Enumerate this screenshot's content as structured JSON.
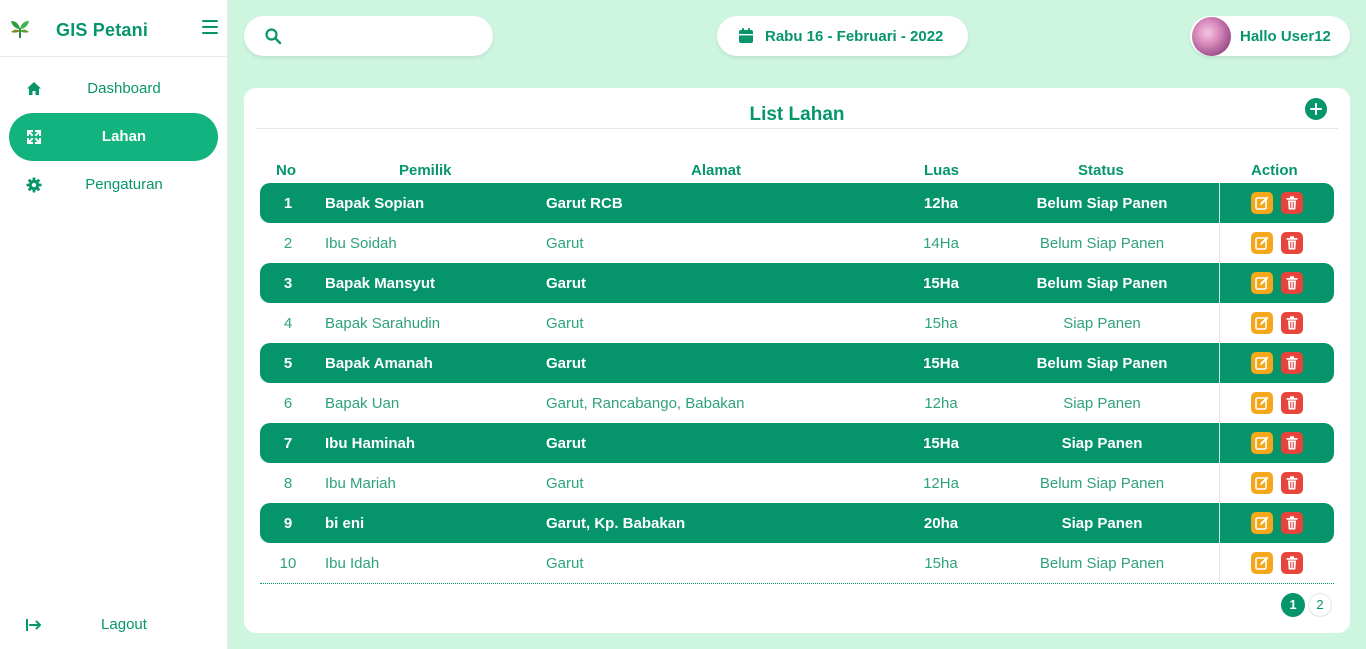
{
  "sidebar": {
    "brand": "GIS Petani",
    "items": [
      {
        "label": "Dashboard",
        "icon": "home-icon"
      },
      {
        "label": "Lahan",
        "icon": "expand-icon"
      },
      {
        "label": "Pengaturan",
        "icon": "gear-icon"
      }
    ],
    "logout": "Lagout"
  },
  "topbar": {
    "search": {
      "value": "",
      "placeholder": ""
    },
    "date": "Rabu 16 - Februari - 2022",
    "user": "Hallo User12"
  },
  "card": {
    "title": "List Lahan",
    "columns": [
      "No",
      "Pemilik",
      "Alamat",
      "Luas",
      "Status",
      "Action"
    ],
    "rows": [
      {
        "no": "1",
        "pemilik": "Bapak Sopian",
        "alamat": "Garut RCB",
        "luas": "12ha",
        "status": "Belum Siap Panen"
      },
      {
        "no": "2",
        "pemilik": "Ibu Soidah",
        "alamat": "Garut",
        "luas": "14Ha",
        "status": "Belum Siap Panen"
      },
      {
        "no": "3",
        "pemilik": "Bapak Mansyut",
        "alamat": "Garut",
        "luas": "15Ha",
        "status": "Belum Siap Panen"
      },
      {
        "no": "4",
        "pemilik": "Bapak Sarahudin",
        "alamat": "Garut",
        "luas": "15ha",
        "status": "Siap Panen"
      },
      {
        "no": "5",
        "pemilik": "Bapak Amanah",
        "alamat": "Garut",
        "luas": "15Ha",
        "status": "Belum Siap Panen"
      },
      {
        "no": "6",
        "pemilik": "Bapak Uan",
        "alamat": "Garut, Rancabango, Babakan",
        "luas": "12ha",
        "status": "Siap Panen"
      },
      {
        "no": "7",
        "pemilik": "Ibu Haminah",
        "alamat": "Garut",
        "luas": "15Ha",
        "status": "Siap Panen"
      },
      {
        "no": "8",
        "pemilik": "Ibu Mariah",
        "alamat": "Garut",
        "luas": "12Ha",
        "status": "Belum Siap Panen"
      },
      {
        "no": "9",
        "pemilik": "bi eni",
        "alamat": "Garut, Kp. Babakan",
        "luas": "20ha",
        "status": "Siap Panen"
      },
      {
        "no": "10",
        "pemilik": "Ibu Idah",
        "alamat": "Garut",
        "luas": "15ha",
        "status": "Belum Siap Panen"
      }
    ],
    "pagination": [
      "1",
      "2"
    ],
    "current_page": "1"
  },
  "colors": {
    "primary": "#06946a",
    "sidebar_active": "#12b37e",
    "background": "#cdf5e0",
    "edit": "#f4a71b",
    "delete": "#e6453e"
  }
}
